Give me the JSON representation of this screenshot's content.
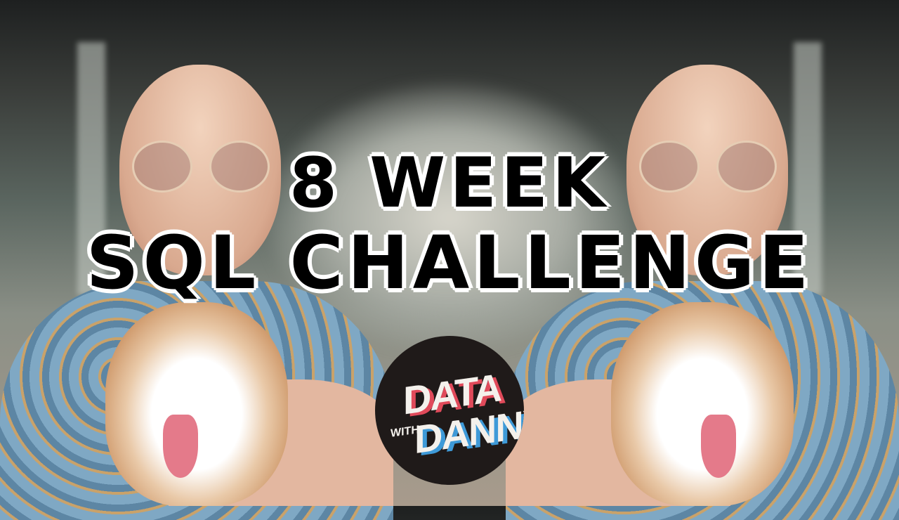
{
  "title": {
    "line1": "8 WEEK",
    "line2": "SQL CHALLENGE"
  },
  "logo": {
    "data": "DATA",
    "with": "WITH",
    "danny": "DANNY"
  },
  "colors": {
    "logo_red": "#e04a5a",
    "logo_blue": "#3e9ad8",
    "logo_bg": "#1f1a19"
  }
}
